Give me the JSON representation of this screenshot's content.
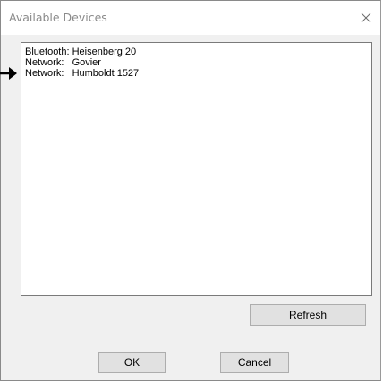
{
  "window": {
    "title": "Available Devices",
    "close_icon": "close-icon"
  },
  "devices": [
    {
      "label": "Bluetooth: Heisenberg 20",
      "selected_marker": false
    },
    {
      "label": "Network:   Govier",
      "selected_marker": true
    },
    {
      "label": "Network:   Humboldt 1527",
      "selected_marker": false
    }
  ],
  "buttons": {
    "refresh": "Refresh",
    "ok": "OK",
    "cancel": "Cancel"
  },
  "colors": {
    "window_bg": "#f0f0f0",
    "button_bg": "#e1e1e1",
    "list_bg": "#ffffff",
    "title_text": "#8a8a8a"
  }
}
